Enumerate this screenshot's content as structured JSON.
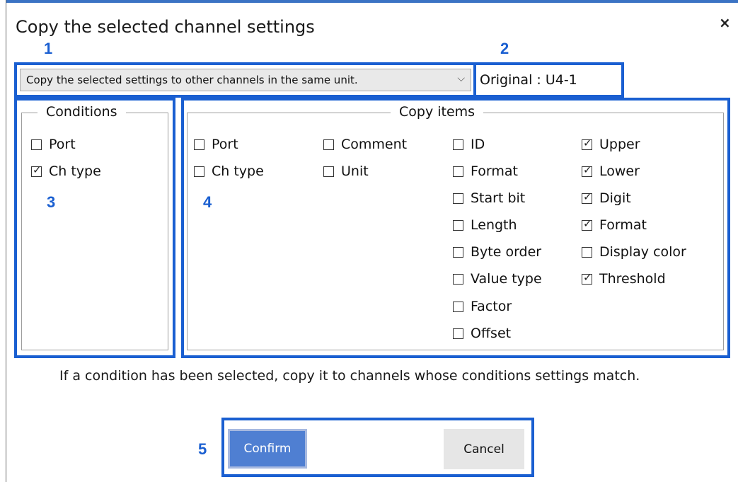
{
  "dialog": {
    "title": "Copy the selected channel settings",
    "close_glyph": "×"
  },
  "annotations": {
    "n1": "1",
    "n2": "2",
    "n3": "3",
    "n4": "4",
    "n5": "5"
  },
  "copy_mode": {
    "selected": "Copy the selected settings to other channels in the same unit.",
    "chevron": "⌵"
  },
  "original": "Original : U4-1",
  "conditions": {
    "legend": "Conditions",
    "items": [
      {
        "label": "Port",
        "checked": false
      },
      {
        "label": "Ch type",
        "checked": true
      }
    ]
  },
  "copy_items": {
    "legend": "Copy items",
    "col1": [
      {
        "label": "Port",
        "checked": false
      },
      {
        "label": "Ch type",
        "checked": false
      }
    ],
    "col2": [
      {
        "label": "Comment",
        "checked": false
      },
      {
        "label": "Unit",
        "checked": false
      }
    ],
    "col3": [
      {
        "label": "ID",
        "checked": false
      },
      {
        "label": "Format",
        "checked": false
      },
      {
        "label": "Start bit",
        "checked": false
      },
      {
        "label": "Length",
        "checked": false
      },
      {
        "label": "Byte order",
        "checked": false
      },
      {
        "label": "Value type",
        "checked": false
      },
      {
        "label": "Factor",
        "checked": false
      },
      {
        "label": "Offset",
        "checked": false
      }
    ],
    "col4": [
      {
        "label": "Upper",
        "checked": true
      },
      {
        "label": "Lower",
        "checked": true
      },
      {
        "label": "Digit",
        "checked": true
      },
      {
        "label": "Format",
        "checked": true
      },
      {
        "label": "Display color",
        "checked": false
      },
      {
        "label": "Threshold",
        "checked": true
      }
    ]
  },
  "info_text": "If a condition has been selected, copy it to channels whose conditions settings match.",
  "buttons": {
    "confirm": "Confirm",
    "cancel": "Cancel"
  },
  "colors": {
    "annotation_blue": "#1a5fd1",
    "confirm_bg": "#4f7fd2",
    "window_accent": "#3b73c4"
  }
}
